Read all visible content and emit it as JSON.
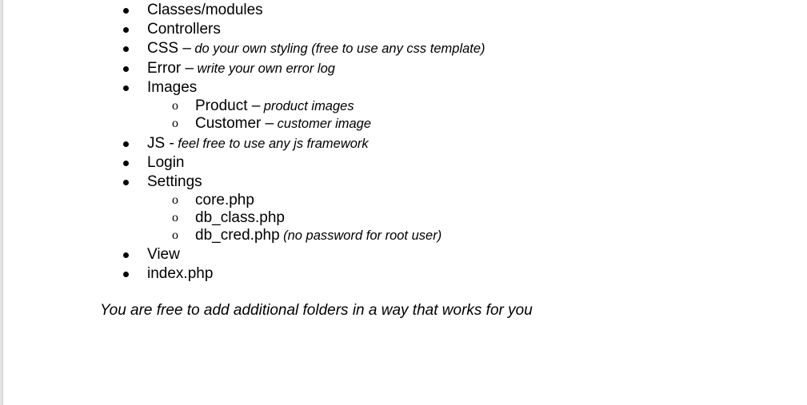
{
  "folders": [
    {
      "label": "Classes/modules",
      "note": ""
    },
    {
      "label": "Controllers",
      "note": ""
    },
    {
      "label": "CSS –",
      "note": "do your own styling (free to use any css template)"
    },
    {
      "label": "Error –",
      "note": "write your own error log"
    },
    {
      "label": "Images",
      "note": "",
      "children": [
        {
          "label": "Product –",
          "note": "product images"
        },
        {
          "label": "Customer –",
          "note": "customer image"
        }
      ]
    },
    {
      "label": "JS -",
      "note": "feel free to use any js framework"
    },
    {
      "label": "Login",
      "note": ""
    },
    {
      "label": "Settings",
      "note": "",
      "children": [
        {
          "label": "core.php",
          "note": ""
        },
        {
          "label": "db_class.php",
          "note": ""
        },
        {
          "label": "db_cred.php",
          "note": "(no password for root user)"
        }
      ]
    },
    {
      "label": "View",
      "note": ""
    },
    {
      "label": "index.php",
      "note": ""
    }
  ],
  "sub_bullet_glyph": "o",
  "footer_note": "You are free to add additional folders in a way that works for you"
}
